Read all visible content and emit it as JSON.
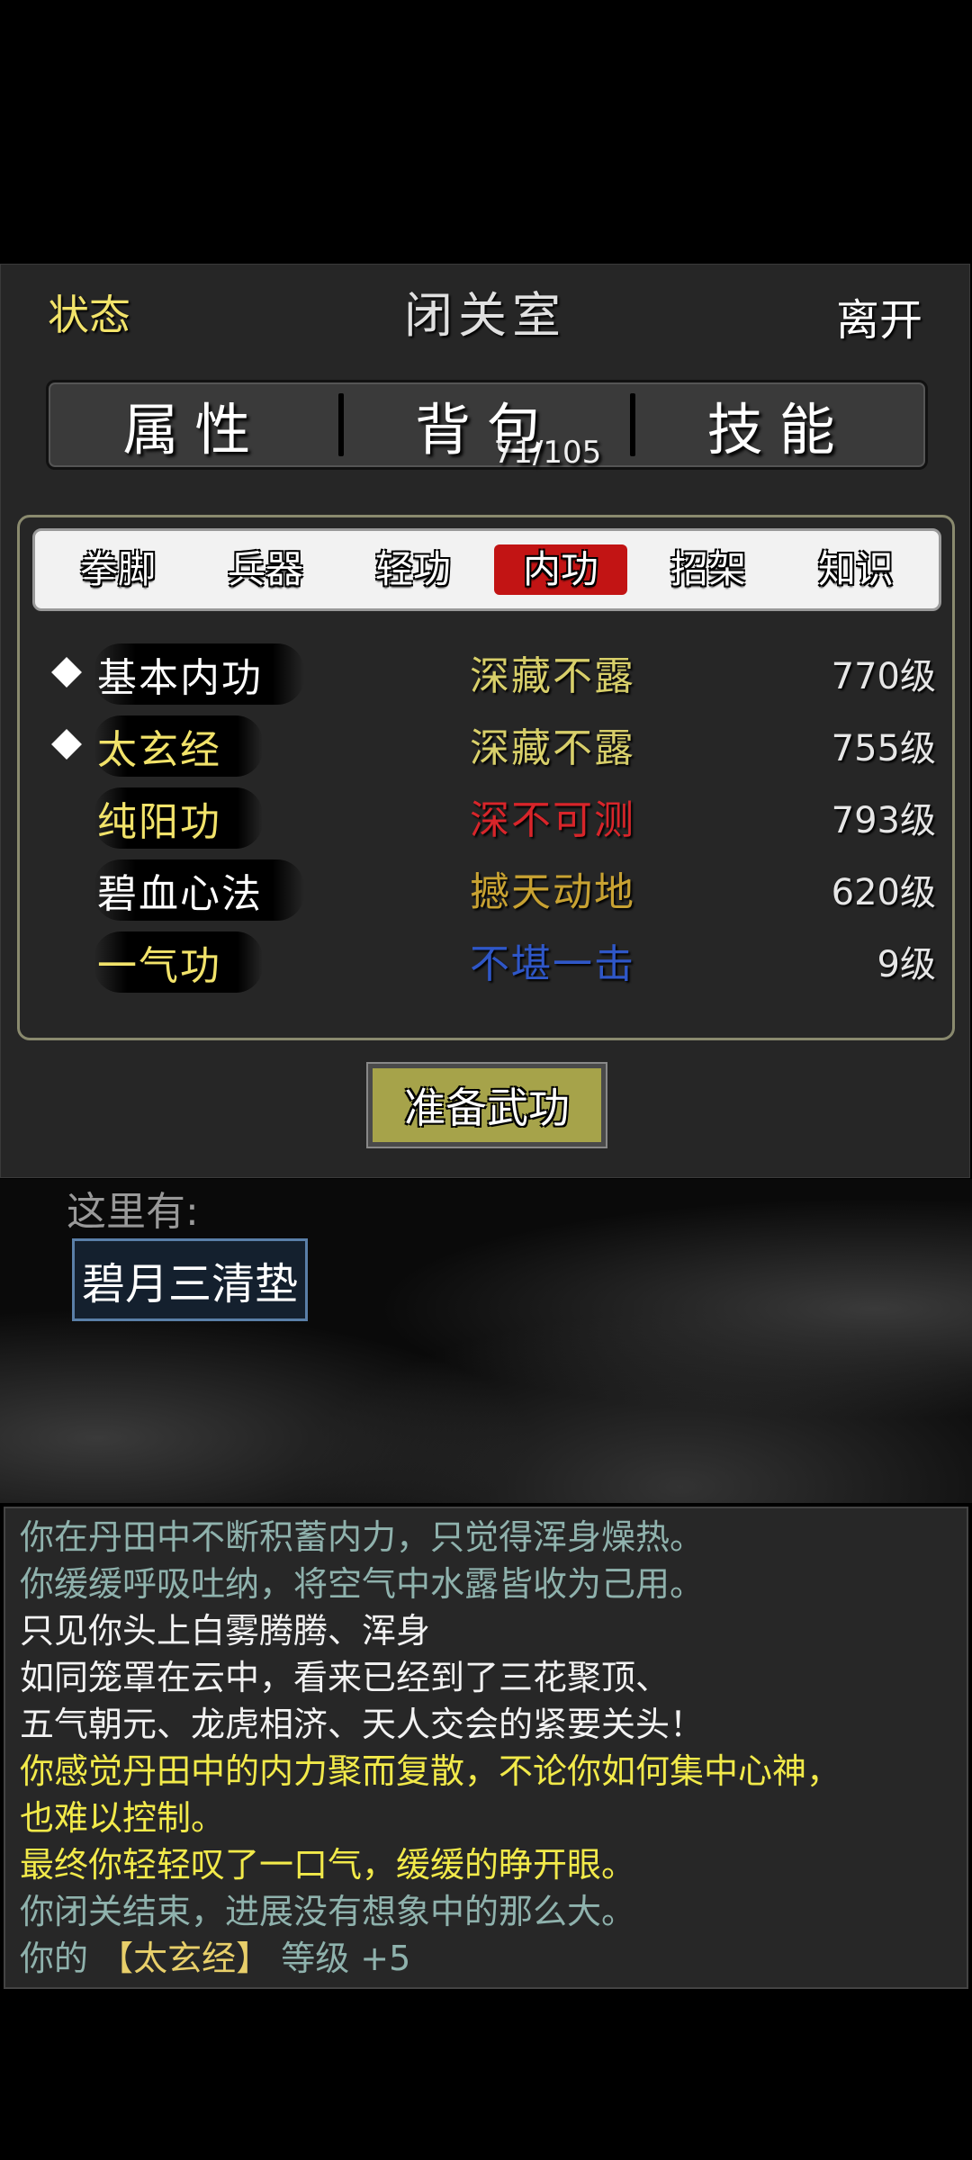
{
  "header": {
    "status_label": "状态",
    "title": "闭关室",
    "leave_label": "离开"
  },
  "main_tabs": {
    "attributes": "属性",
    "bag": "背包",
    "bag_count": "71/105",
    "skills": "技能"
  },
  "sub_tabs": [
    "拳脚",
    "兵器",
    "轻功",
    "内功",
    "招架",
    "知识"
  ],
  "active_sub_tab": "内功",
  "skills": [
    {
      "name": "基本内功",
      "equipped": true,
      "level_text": "深藏不露",
      "level": "770级",
      "name_color": "#ffffff",
      "level_color": "#d8cf6a"
    },
    {
      "name": "太玄经",
      "equipped": true,
      "level_text": "深藏不露",
      "level": "755级",
      "name_color": "#f2e36a",
      "level_color": "#d8cf6a"
    },
    {
      "name": "纯阳功",
      "equipped": false,
      "level_text": "深不可测",
      "level": "793级",
      "name_color": "#f2e36a",
      "level_color": "#d8252a"
    },
    {
      "name": "碧血心法",
      "equipped": false,
      "level_text": "撼天动地",
      "level": "620级",
      "name_color": "#ffffff",
      "level_color": "#c8a232"
    },
    {
      "name": "一气功",
      "equipped": false,
      "level_text": "不堪一击",
      "level": "9级",
      "name_color": "#f2e36a",
      "level_color": "#2f57c8"
    }
  ],
  "prepare_button": "准备武功",
  "room": {
    "here_label": "这里有:",
    "item": "碧月三清垫"
  },
  "log": [
    {
      "text": "你在丹田中不断积蓄内力，只觉得浑身燥热。",
      "color": "teal"
    },
    {
      "text": "你缓缓呼吸吐纳，将空气中水露皆收为己用。",
      "color": "teal"
    },
    {
      "text": "只见你头上白雾腾腾、浑身",
      "color": "white"
    },
    {
      "text": "如同笼罩在云中，看来已经到了三花聚顶、",
      "color": "white"
    },
    {
      "text": "五气朝元、龙虎相济、天人交会的紧要关头！",
      "color": "white"
    },
    {
      "text": "你感觉丹田中的内力聚而复散，不论你如何集中心神，",
      "color": "yellow"
    },
    {
      "text": "也难以控制。",
      "color": "yellow"
    },
    {
      "text": "最终你轻轻叹了一口气，缓缓的睁开眼。",
      "color": "yellow"
    },
    {
      "text": "你闭关结束，进展没有想象中的那么大。",
      "color": "teal"
    }
  ],
  "log_last": {
    "prefix": "你的",
    "skill": "【太玄经】",
    "suffix": "等级 +5"
  }
}
